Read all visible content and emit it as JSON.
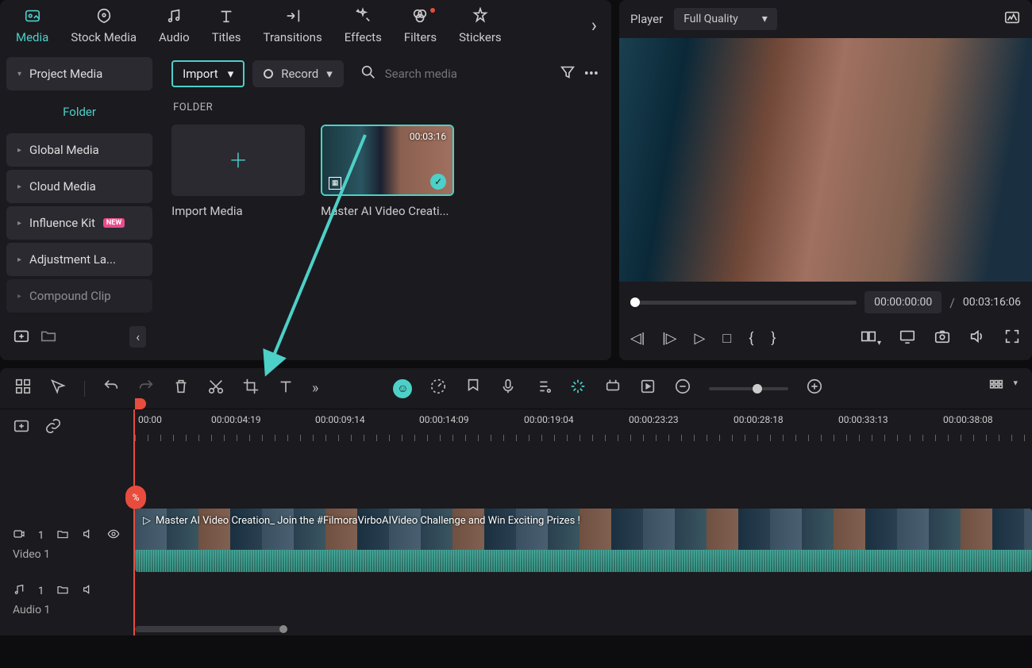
{
  "tabs": {
    "media": "Media",
    "stock": "Stock Media",
    "audio": "Audio",
    "titles": "Titles",
    "transitions": "Transitions",
    "effects": "Effects",
    "filters": "Filters",
    "stickers": "Stickers"
  },
  "sidebar": {
    "project": "Project Media",
    "folder": "Folder",
    "global": "Global Media",
    "cloud": "Cloud Media",
    "influence": "Influence Kit",
    "influence_badge": "NEW",
    "adjustment": "Adjustment La...",
    "compound": "Compound Clip"
  },
  "toolbar": {
    "import": "Import",
    "record": "Record",
    "search_ph": "Search media"
  },
  "content": {
    "folder_label": "FOLDER",
    "import_media": "Import Media",
    "clip1_name": "Master AI Video Creati...",
    "clip1_dur": "00:03:16"
  },
  "player": {
    "label": "Player",
    "quality": "Full Quality",
    "current": "00:00:00:00",
    "sep": "/",
    "total": "00:03:16:06"
  },
  "timeline": {
    "ruler": [
      "00:00",
      "00:00:04:19",
      "00:00:09:14",
      "00:00:14:09",
      "00:00:19:04",
      "00:00:23:23",
      "00:00:28:18",
      "00:00:33:13",
      "00:00:38:08"
    ],
    "clip_title": "Master AI Video Creation_ Join the #FilmoraVirboAIVideo Challenge and Win Exciting Prizes !",
    "track_v_num": "1",
    "track_v": "Video 1",
    "track_a_num": "1",
    "track_a": "Audio 1",
    "cut": "%"
  }
}
